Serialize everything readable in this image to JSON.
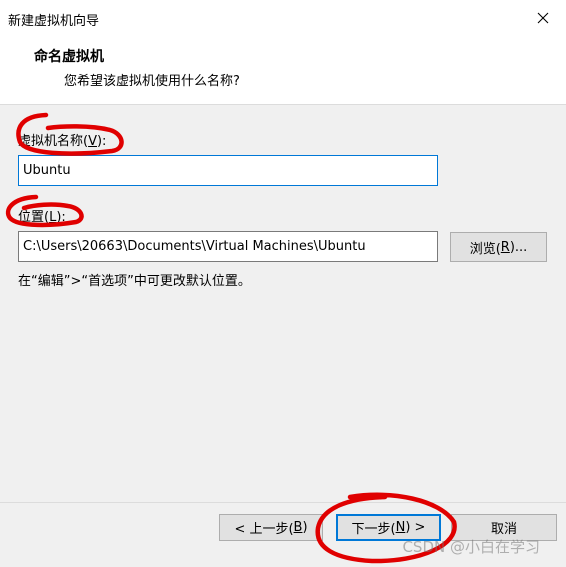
{
  "window": {
    "title": "新建虚拟机向导"
  },
  "header": {
    "title": "命名虚拟机",
    "subtitle": "您希望该虚拟机使用什么名称?"
  },
  "vm_name": {
    "label_prefix": "虚拟机名称(",
    "label_key": "V",
    "label_suffix": "):",
    "value": "Ubuntu"
  },
  "location": {
    "label_prefix": "位置(",
    "label_key": "L",
    "label_suffix": "):",
    "value": "C:\\Users\\20663\\Documents\\Virtual Machines\\Ubuntu",
    "browse_prefix": "浏览(",
    "browse_key": "R",
    "browse_suffix": ")...",
    "hint": "在“编辑”>“首选项”中可更改默认位置。"
  },
  "footer": {
    "back_prefix": "< 上一步(",
    "back_key": "B",
    "back_suffix": ")",
    "next_prefix": "下一步(",
    "next_key": "N",
    "next_suffix": ") >",
    "cancel_label": "取消"
  },
  "watermark": "CSDN @小白在学习",
  "colors": {
    "annotation": "#e00000",
    "focus": "#0078d7"
  }
}
